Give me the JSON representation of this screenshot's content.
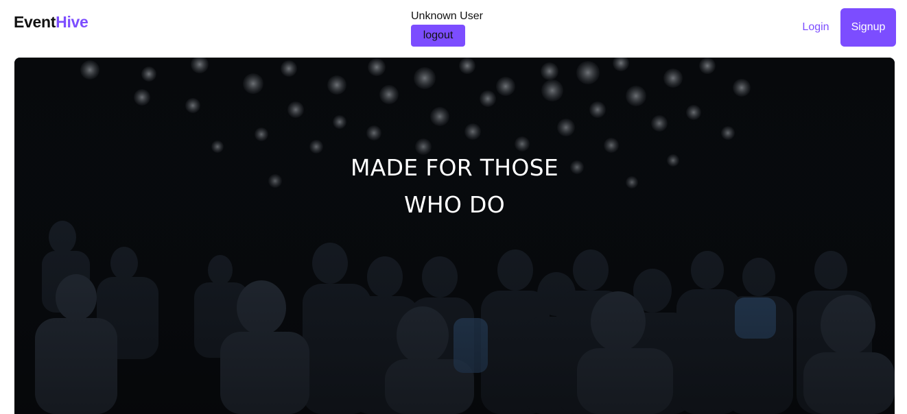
{
  "header": {
    "logo": {
      "part1": "Event",
      "part2": "Hive"
    },
    "user": {
      "name": "Unknown User",
      "logout_label": "logout"
    },
    "nav": {
      "login_label": "Login",
      "signup_label": "Signup"
    }
  },
  "hero": {
    "title_line1": "MADE FOR THOSE",
    "title_line2": "WHO DO"
  },
  "colors": {
    "accent": "#7c4dff",
    "text": "#111111",
    "hero_background": "#07090c"
  }
}
